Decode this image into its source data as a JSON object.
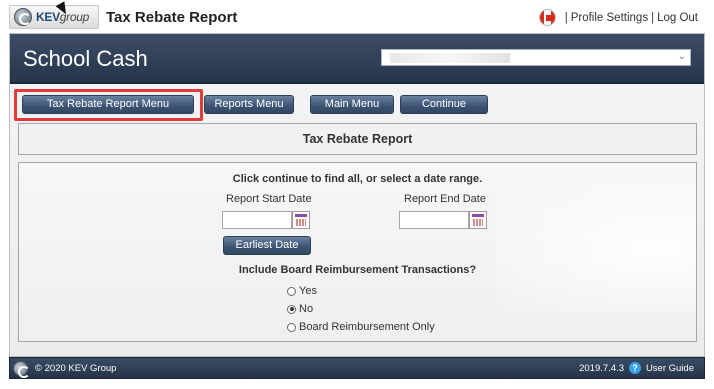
{
  "header": {
    "logo_text": "KEV",
    "logo_suffix": "group",
    "page_title": "Tax Rebate Report",
    "links": {
      "sep": "|",
      "profile_settings": "Profile Settings",
      "log_out": "Log Out"
    }
  },
  "banner": {
    "brand": "School Cash",
    "school_select_value": ""
  },
  "buttons": {
    "tax_rebate_menu": "Tax Rebate Report Menu",
    "reports_menu": "Reports Menu",
    "main_menu": "Main Menu",
    "continue": "Continue"
  },
  "section_title": "Tax Rebate Report",
  "form": {
    "instruction": "Click continue to find all, or select a date range.",
    "start_label": "Report Start Date",
    "end_label": "Report End Date",
    "start_value": "",
    "end_value": "",
    "earliest_button": "Earliest Date",
    "question": "Include Board Reimbursement Transactions?",
    "options": [
      {
        "label": "Yes",
        "selected": false
      },
      {
        "label": "No",
        "selected": true
      },
      {
        "label": "Board Reimbursement Only",
        "selected": false
      }
    ]
  },
  "footer": {
    "copyright": "© 2020 KEV Group",
    "version": "2019.7.4.3",
    "help_icon": "?",
    "user_guide": "User Guide"
  },
  "colors": {
    "banner": "#2c3d55",
    "button": "#3d5373",
    "highlight": "#e03a3a"
  }
}
